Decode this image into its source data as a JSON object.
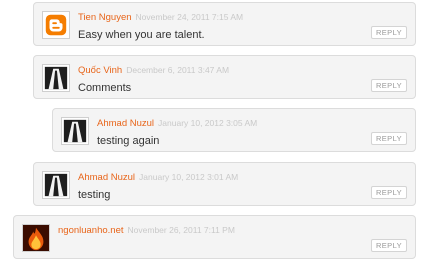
{
  "comments": [
    {
      "author": "Tien Nguyen",
      "date": "November 24, 2011 7:15 AM",
      "text": "Easy when you are talent.",
      "reply": "REPLY",
      "avatar_icon": "blogger-logo-icon"
    },
    {
      "author": "Quốc Vinh",
      "date": "December 6, 2011 3:47 AM",
      "text": "Comments",
      "reply": "REPLY",
      "avatar_icon": "road-avatar-icon"
    },
    {
      "author": "Ahmad Nuzul",
      "date": "January 10, 2012 3:05 AM",
      "text": "testing again",
      "reply": "REPLY",
      "avatar_icon": "road-avatar-icon"
    },
    {
      "author": "Ahmad Nuzul",
      "date": "January 10, 2012 3:01 AM",
      "text": "testing",
      "reply": "REPLY",
      "avatar_icon": "road-avatar-icon"
    },
    {
      "author": "ngonluanho.net",
      "date": "November 26, 2011 7:11 PM",
      "text": "",
      "reply": "REPLY",
      "avatar_icon": "flame-avatar-icon"
    }
  ],
  "colors": {
    "author": "#e8651a",
    "date": "#c9c9c9",
    "card_bg": "#f4f4f4",
    "card_border": "#dcdcdc"
  }
}
